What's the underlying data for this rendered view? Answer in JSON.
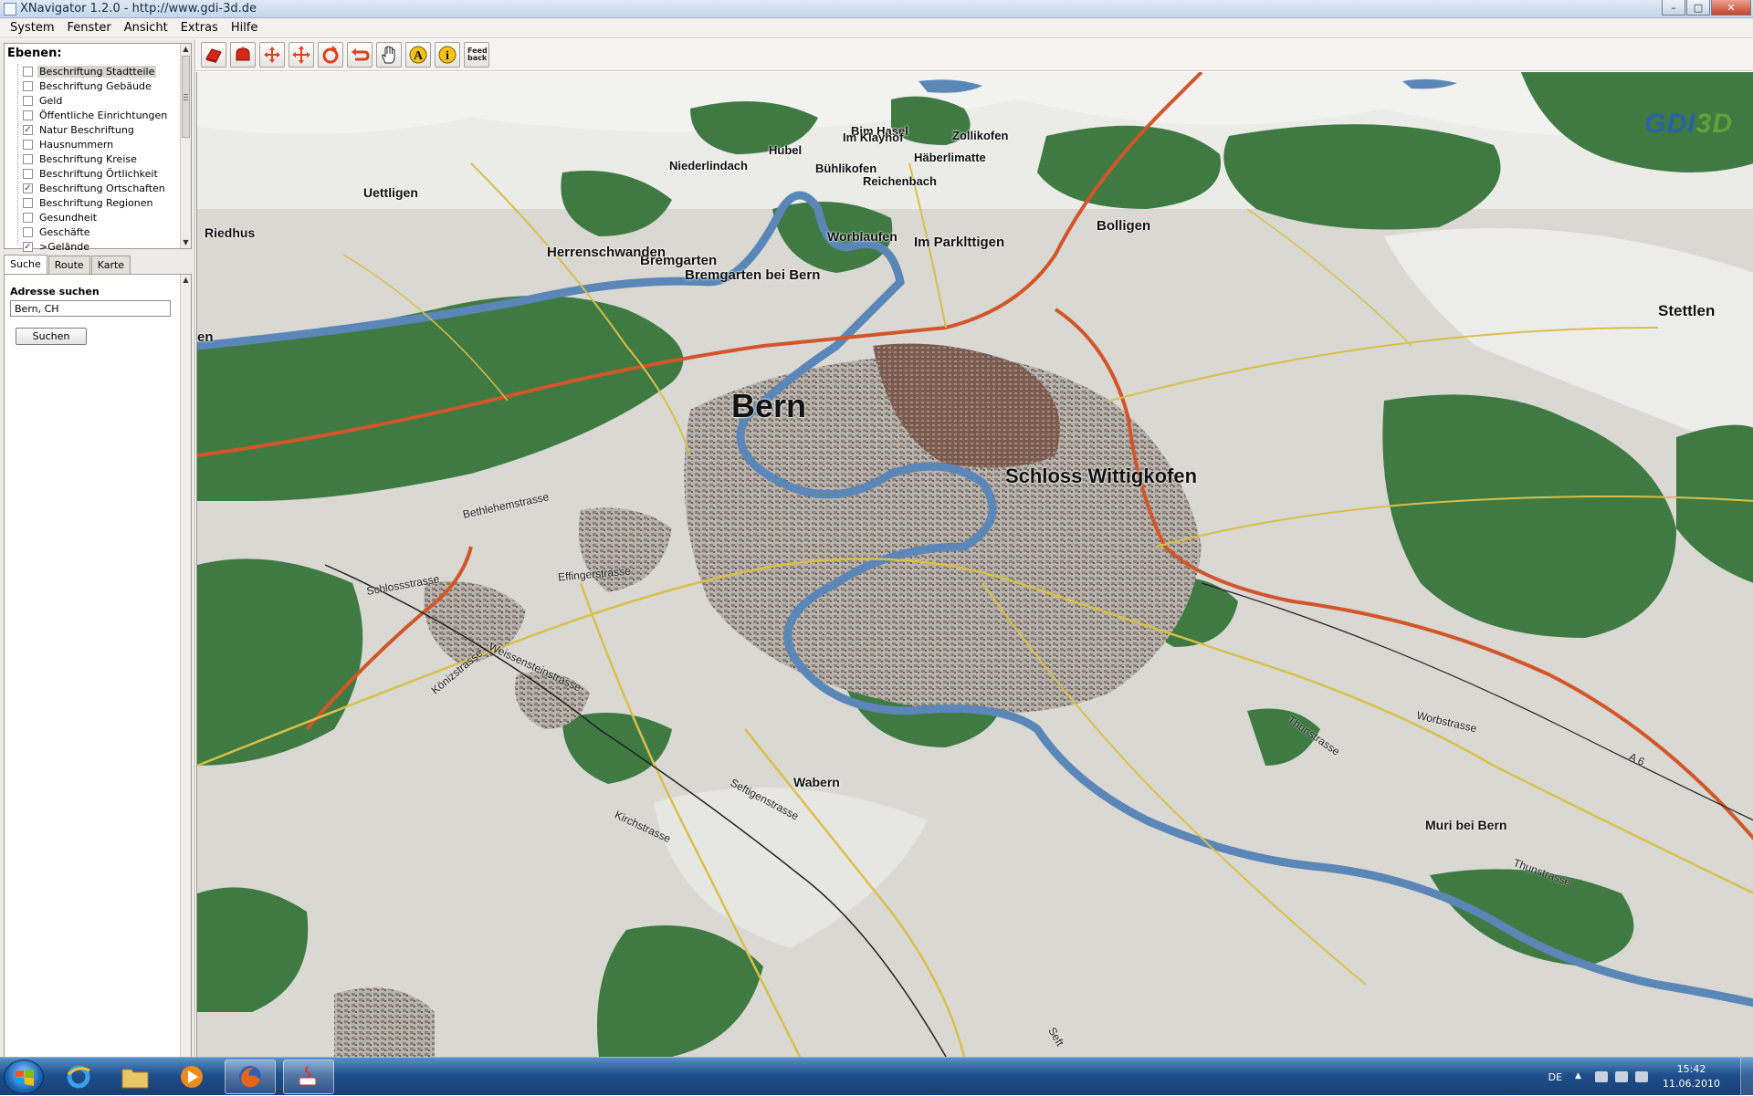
{
  "window": {
    "title": "XNavigator 1.2.0 - http://www.gdi-3d.de",
    "controls": [
      "–",
      "□",
      "✕"
    ]
  },
  "menu": [
    "System",
    "Fenster",
    "Ansicht",
    "Extras",
    "Hilfe"
  ],
  "layers": {
    "title": "Ebenen:",
    "items": [
      {
        "label": "Beschriftung Stadtteile",
        "checked": false,
        "selected": true
      },
      {
        "label": "Beschriftung Gebäude",
        "checked": false
      },
      {
        "label": "Geld",
        "checked": false
      },
      {
        "label": "Öffentliche Einrichtungen",
        "checked": false
      },
      {
        "label": "Natur Beschriftung",
        "checked": true
      },
      {
        "label": "Hausnummern",
        "checked": false
      },
      {
        "label": "Beschriftung Kreise",
        "checked": false
      },
      {
        "label": "Beschriftung Örtlichkeit",
        "checked": false
      },
      {
        "label": "Beschriftung Ortschaften",
        "checked": true
      },
      {
        "label": "Beschriftung Regionen",
        "checked": false
      },
      {
        "label": "Gesundheit",
        "checked": false
      },
      {
        "label": "Geschäfte",
        "checked": false
      },
      {
        "label": ">Gelände",
        "checked": true
      }
    ]
  },
  "tabs": [
    {
      "label": "Suche",
      "active": true
    },
    {
      "label": "Route",
      "active": false
    },
    {
      "label": "Karte",
      "active": false
    }
  ],
  "search": {
    "section_title": "Adresse suchen",
    "value": "Bern, CH",
    "button": "Suchen"
  },
  "toolbar": {
    "tools": [
      "move-icon",
      "tilt-icon",
      "pan-icon",
      "zoom-icon",
      "rotate-icon",
      "undo-icon",
      "hand-icon",
      "label-icon",
      "info-icon",
      "feedback-icon"
    ],
    "feedback_label": "Feed back",
    "label_tool_letter": "A",
    "info_tool_letter": "i"
  },
  "map": {
    "logo_text": "GDI",
    "logo_3d": "3D",
    "places": [
      {
        "name": "Bern",
        "size": 36
      },
      {
        "name": "Schloss Wittigkofen",
        "size": 22
      },
      {
        "name": "Stettlen",
        "size": 17
      },
      {
        "name": "Bolligen",
        "size": 15
      },
      {
        "name": "Im Parklttigen",
        "size": 15
      },
      {
        "name": "Worblaufen",
        "size": 14
      },
      {
        "name": "Bremgarten",
        "size": 15
      },
      {
        "name": "Bremgarten bei Bern",
        "size": 15
      },
      {
        "name": "Herrenschwanden",
        "size": 15
      },
      {
        "name": "Uettligen",
        "size": 14
      },
      {
        "name": "Riedhus",
        "size": 14
      },
      {
        "name": "Niederlindach",
        "size": 13
      },
      {
        "name": "Hubel",
        "size": 13
      },
      {
        "name": "Bim Hasel",
        "size": 13
      },
      {
        "name": "Im Klayhof",
        "size": 13
      },
      {
        "name": "Zollikofen",
        "size": 13
      },
      {
        "name": "Häberlimatte",
        "size": 13
      },
      {
        "name": "Bühlikofen",
        "size": 13
      },
      {
        "name": "Reichenbach",
        "size": 13
      },
      {
        "name": "Wabern",
        "size": 14
      },
      {
        "name": "Muri bei Bern",
        "size": 14
      },
      {
        "name": "en",
        "size": 15
      }
    ],
    "streets": [
      "Worbstrasse",
      "Thunstrasse",
      "Thunstrasse",
      "Seftigenstrasse",
      "Kirchstrasse",
      "Weissensteinstrasse",
      "Schlossstrasse",
      "Effingerstrasse",
      "Bethlehemstrasse",
      "Könizstrasse",
      "A 6",
      "Seft"
    ],
    "colors": {
      "forest": "#3f7a42",
      "terrain": "#d9d8d3",
      "river": "#5b86b8",
      "highway": "#d2562a",
      "road": "#d8c04a"
    }
  },
  "taskbar": {
    "language": "DE",
    "time": "15:42",
    "date": "11.06.2010"
  }
}
